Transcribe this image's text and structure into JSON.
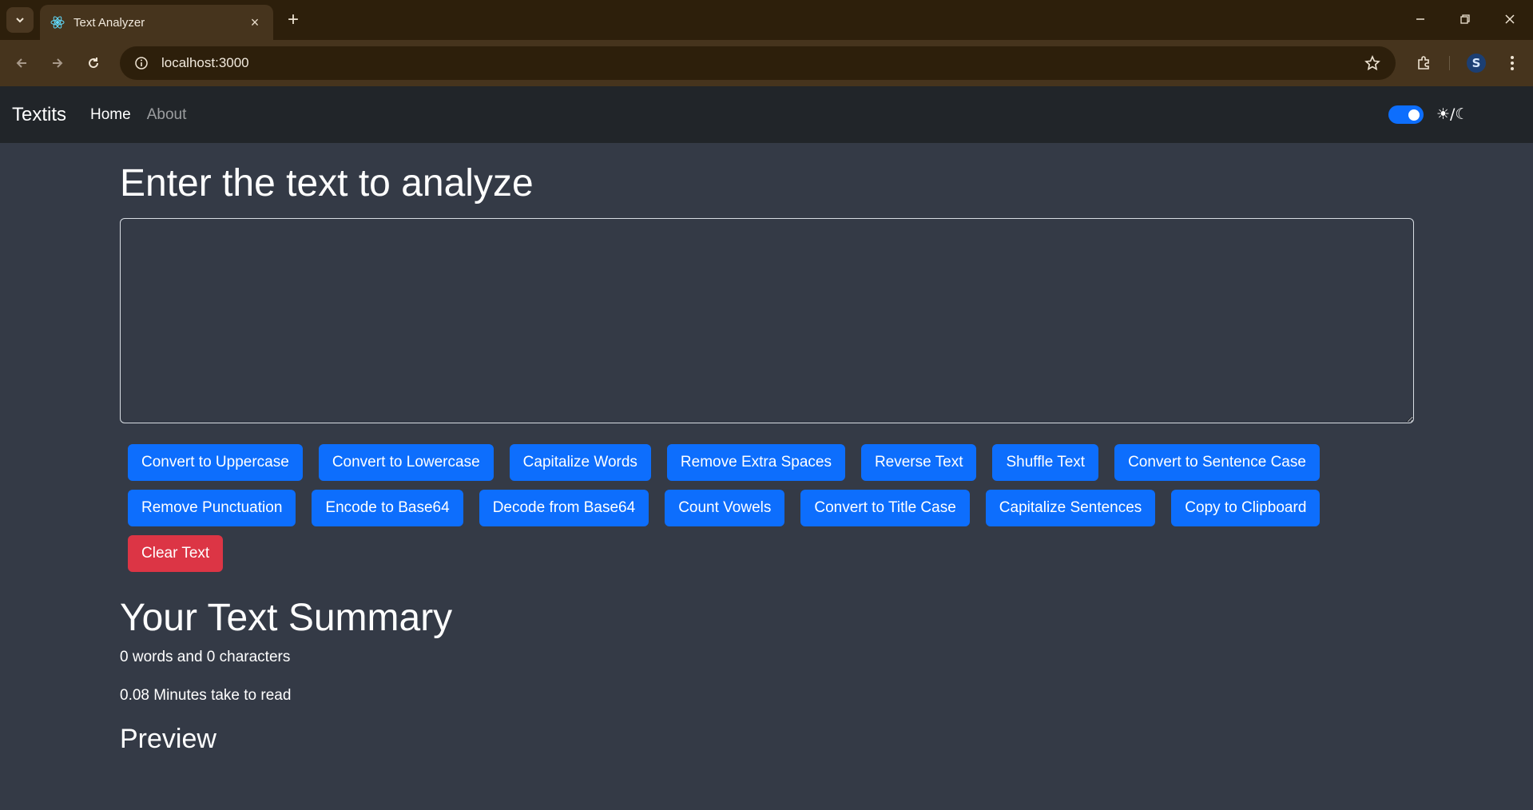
{
  "browser": {
    "tab_title": "Text Analyzer",
    "url": "localhost:3000"
  },
  "navbar": {
    "brand": "Textits",
    "links": [
      "Home",
      "About"
    ],
    "mode_label": "☀/☾",
    "dark_mode_enabled": true
  },
  "main": {
    "heading": "Enter the text to analyze",
    "textarea_value": "",
    "buttons": [
      "Convert to Uppercase",
      "Convert to Lowercase",
      "Capitalize Words",
      "Remove Extra Spaces",
      "Reverse Text",
      "Shuffle Text",
      "Convert to Sentence Case",
      "Remove Punctuation",
      "Encode to Base64",
      "Decode from Base64",
      "Count Vowels",
      "Convert to Title Case",
      "Capitalize Sentences",
      "Copy to Clipboard"
    ],
    "clear_button": "Clear Text"
  },
  "summary": {
    "heading": "Your Text Summary",
    "counts": "0 words and 0 characters",
    "read_time": "0.08 Minutes take to read",
    "preview_heading": "Preview"
  },
  "colors": {
    "primary": "#0d6efd",
    "danger": "#dc3545",
    "page_bg": "#343a46",
    "navbar_bg": "#212529"
  }
}
